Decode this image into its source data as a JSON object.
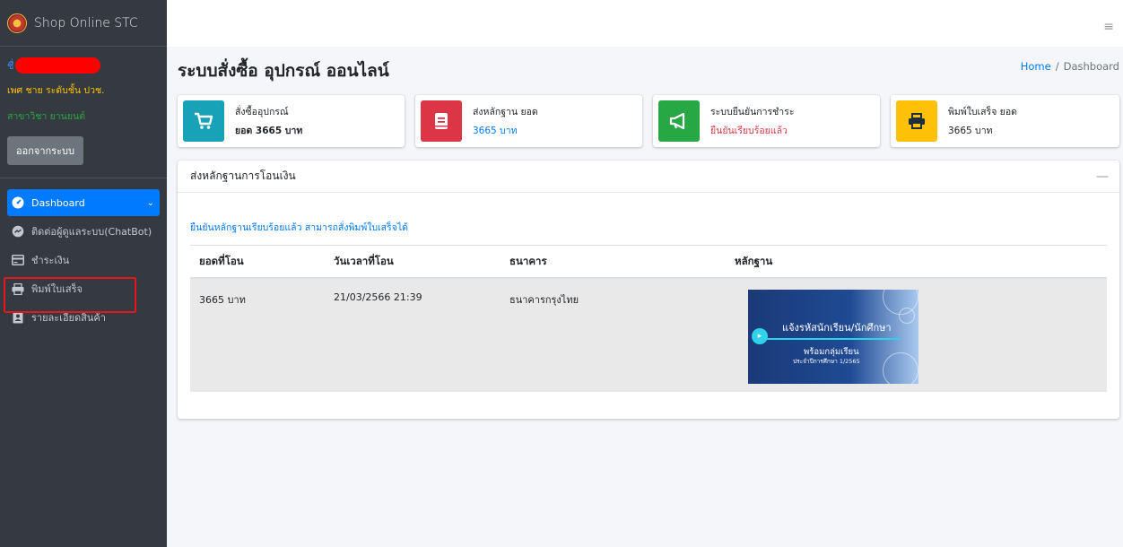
{
  "brand": {
    "title": "Shop Online STC"
  },
  "user": {
    "gender_level": "เพศ ชาย ระดับชั้น ปวช.",
    "branch": "สาขาวิชา ยานยนต์",
    "logout_label": "ออกจากระบบ"
  },
  "nav": {
    "items": [
      {
        "label": "Dashboard",
        "icon": "dashboard-icon",
        "active": true
      },
      {
        "label": "ติดต่อผู้ดูแลระบบ(ChatBot)",
        "icon": "messenger-icon"
      },
      {
        "label": "ชำระเงิน",
        "icon": "payment-icon"
      },
      {
        "label": "พิมพ์ใบเสร็จ",
        "icon": "print-icon"
      },
      {
        "label": "รายละเอียดสินค้า",
        "icon": "contact-card-icon"
      }
    ]
  },
  "header": {
    "page_title": "ระบบสั่งซื้อ อุปกรณ์ ออนไลน์",
    "breadcrumb_home": "Home",
    "breadcrumb_sep": "/",
    "breadcrumb_current": "Dashboard"
  },
  "info_boxes": [
    {
      "label": "สั่งซื้ออุปกรณ์",
      "value": "ยอด 3665 บาท",
      "icon": "cart-icon",
      "color": "#17a2b8",
      "value_color": "#212529"
    },
    {
      "label": "ส่งหลักฐาน ยอด",
      "value": "3665 บาท",
      "icon": "book-icon",
      "color": "#dc3545",
      "value_color": "#007bff"
    },
    {
      "label": "ระบบยืนยันการชำระ",
      "value": "ยืนยันเรียบร้อยแล้ว",
      "icon": "megaphone-icon",
      "color": "#28a745",
      "value_color": "#dc3545"
    },
    {
      "label": "พิมพ์ใบเสร็จ ยอด",
      "value": "3665 บาท",
      "icon": "print-icon",
      "color": "#ffc107",
      "value_color": "#212529"
    }
  ],
  "card": {
    "title": "ส่งหลักฐานการโอนเงิน",
    "message": "ยืนยันหลักฐานเรียบร้อยแล้ว สามารถสั่งพิมพ์ใบเสร็จได้",
    "columns": [
      "ยอดที่โอน",
      "วันเวลาที่โอน",
      "ธนาคาร",
      "หลักฐาน"
    ],
    "rows": [
      {
        "amount": "3665 บาท",
        "datetime": "21/03/2566 21:39",
        "bank": "ธนาคารกรุงไทย"
      }
    ],
    "evidence": {
      "title": "แจ้งรหัสนักเรียน/นักศึกษา",
      "subtitle": "พร้อมกลุ่มเรียน",
      "subtitle2": "ประจำปีการศึกษา 1/2565"
    }
  }
}
